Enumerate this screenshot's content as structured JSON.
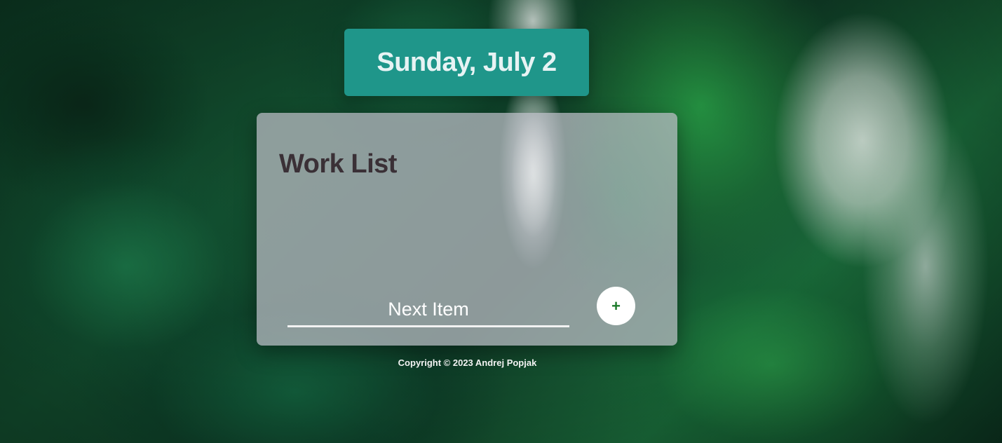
{
  "header": {
    "date": "Sunday, July 2"
  },
  "list": {
    "title": "Work List",
    "input_placeholder": "Next Item",
    "add_button_label": "+"
  },
  "footer": {
    "copyright": "Copyright © 2023 Andrej Popjak"
  },
  "colors": {
    "date_box": "#1f968a",
    "card": "rgba(190,190,200,0.72)",
    "title_text": "#3a3036",
    "add_icon": "#1c7a2a"
  }
}
